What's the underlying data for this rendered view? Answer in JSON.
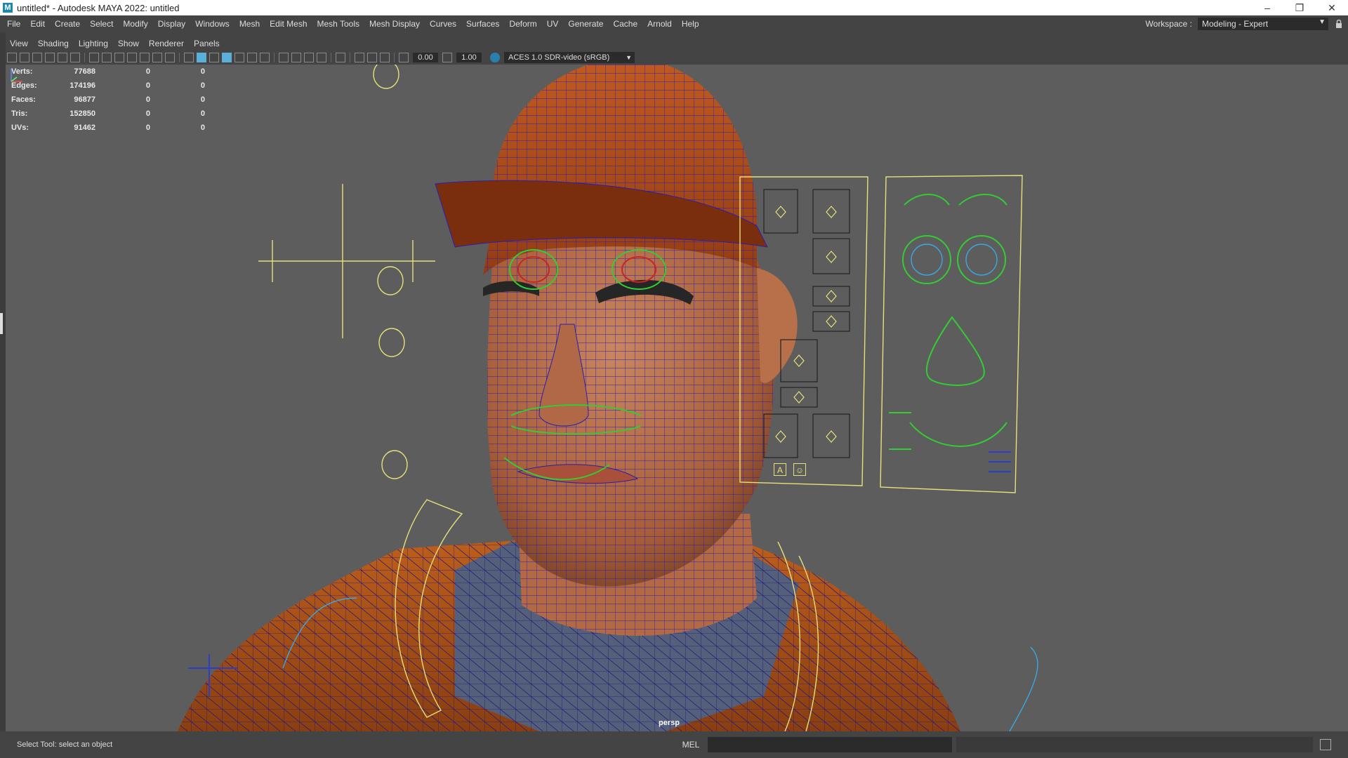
{
  "window": {
    "title": "untitled* - Autodesk MAYA 2022: untitled",
    "logo_letter": "M",
    "controls": [
      "–",
      "❐",
      "✕"
    ]
  },
  "menubar": {
    "items": [
      "File",
      "Edit",
      "Create",
      "Select",
      "Modify",
      "Display",
      "Windows",
      "Mesh",
      "Edit Mesh",
      "Mesh Tools",
      "Mesh Display",
      "Curves",
      "Surfaces",
      "Deform",
      "UV",
      "Generate",
      "Cache",
      "Arnold",
      "Help"
    ]
  },
  "workspace": {
    "label": "Workspace :",
    "value": "Modeling - Expert"
  },
  "panel_menu": {
    "items": [
      "View",
      "Shading",
      "Lighting",
      "Show",
      "Renderer",
      "Panels"
    ]
  },
  "panel_toolbar": {
    "exposure": "0.00",
    "gamma": "1.00",
    "color_space": "ACES 1.0 SDR-video (sRGB)"
  },
  "hud": {
    "rows": [
      {
        "label": "Verts:",
        "value": "77688",
        "sel": "0",
        "comp": "0"
      },
      {
        "label": "Edges:",
        "value": "174196",
        "sel": "0",
        "comp": "0"
      },
      {
        "label": "Faces:",
        "value": "96877",
        "sel": "0",
        "comp": "0"
      },
      {
        "label": "Tris:",
        "value": "152850",
        "sel": "0",
        "comp": "0"
      },
      {
        "label": "UVs:",
        "value": "91462",
        "sel": "0",
        "comp": "0"
      }
    ]
  },
  "viewport": {
    "camera": "persp",
    "colors": {
      "background": "#5d5d5d",
      "skin": "#b5683e",
      "jacket": "#b8551a",
      "wire": "#2a1fb0",
      "control": "#e6e07a",
      "facial_ctrl": "#33cc33",
      "eye_ring": "#3aa8e0"
    },
    "picker_icons": [
      "A",
      "☺"
    ]
  },
  "statusbar": {
    "message": "Select Tool: select an object",
    "mel_label": "MEL"
  }
}
